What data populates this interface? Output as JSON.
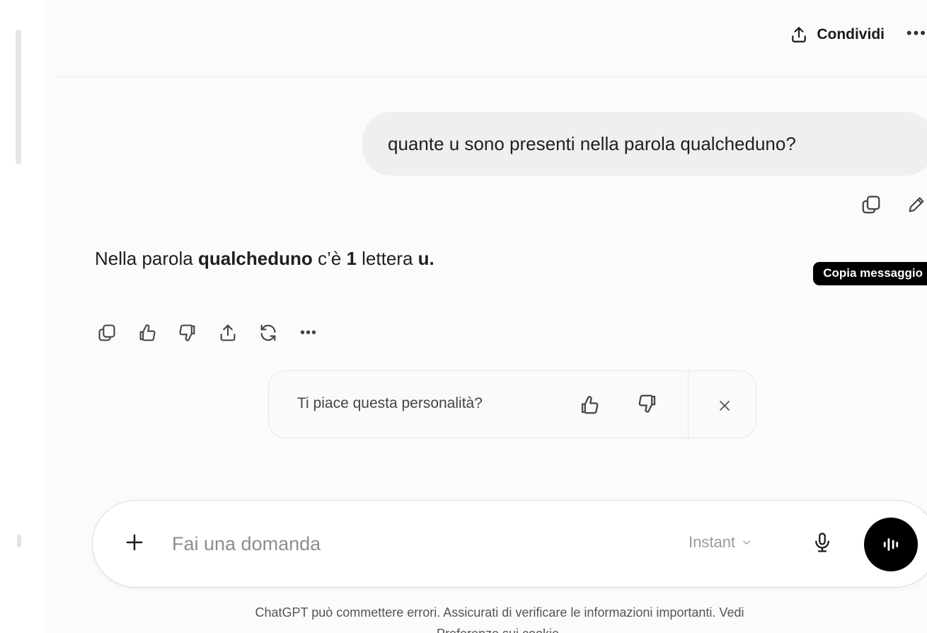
{
  "header": {
    "share_label": "Condividi",
    "more_icon": "more-horizontal-icon"
  },
  "conversation": {
    "user_message": "quante u sono presenti nella parola qualcheduno?",
    "user_actions": [
      "copy-icon",
      "edit-pencil-icon"
    ],
    "tooltip": "Copia messaggio",
    "assistant": {
      "part1": "Nella parola ",
      "word": "qualcheduno",
      "part2": " c’è ",
      "count": "1",
      "part3": " lettera ",
      "letter": "u."
    },
    "assistant_actions": [
      "copy-icon",
      "thumbs-up-icon",
      "thumbs-down-icon",
      "share-icon",
      "regenerate-icon",
      "more-horizontal-icon"
    ]
  },
  "feedback": {
    "question": "Ti piace questa personalità?",
    "icons": [
      "thumbs-up-icon",
      "thumbs-down-icon",
      "close-icon"
    ]
  },
  "composer": {
    "placeholder": "Fai una domanda",
    "model": "Instant",
    "icons": [
      "plus-icon",
      "chevron-down-icon",
      "microphone-icon",
      "voice-waveform-icon"
    ]
  },
  "footer": {
    "disclaimer_line1": "ChatGPT può commettere errori. Assicurati di verificare le informazioni importanti. Vedi",
    "disclaimer_line2": "Preferenze sui cookie."
  },
  "colors": {
    "background": "#fbfbfb",
    "user_bubble": "#efefef",
    "tooltip_bg": "#000000",
    "voice_button": "#000000"
  }
}
